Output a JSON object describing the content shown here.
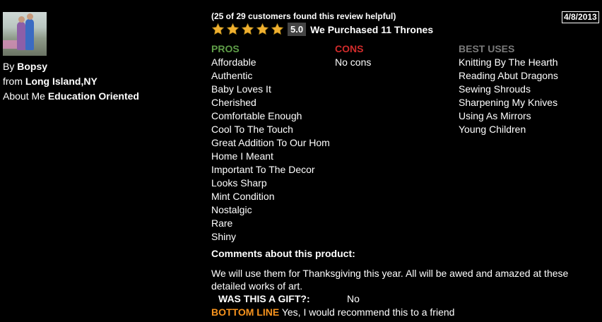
{
  "reviewer": {
    "by_label": "By",
    "name": "Bopsy",
    "from_label": "from",
    "location": "Long Island,NY",
    "about_label": "About Me",
    "about": "Education Oriented"
  },
  "review": {
    "helpful_text": "(25 of 29 customers found this review helpful)",
    "date": "4/8/2013",
    "rating": "5.0",
    "stars": 5,
    "headline": "We Purchased 11 Thrones"
  },
  "pros": {
    "label": "PROS",
    "items": [
      "Affordable",
      "Authentic",
      "Baby Loves It",
      "Cherished",
      "Comfortable Enough",
      "Cool To The Touch",
      "Great Addition To Our Hom",
      "Home I Meant",
      "Important To The Decor",
      "Looks Sharp",
      "Mint Condition",
      "Nostalgic",
      "Rare",
      "Shiny"
    ]
  },
  "cons": {
    "label": "CONS",
    "items": [
      "No cons"
    ]
  },
  "best_uses": {
    "label": "BEST USES",
    "items": [
      "Knitting By The Hearth",
      "Reading Abut Dragons",
      "Sewing Shrouds",
      "Sharpening My Knives",
      "Using As Mirrors",
      "Young Children"
    ]
  },
  "comments": {
    "label": "Comments about this product:",
    "text": "We will use them for Thanksgiving this year. All will be awed and amazed at these detailed works of art."
  },
  "gift": {
    "label": "WAS THIS A GIFT?:",
    "value": "No"
  },
  "bottom_line": {
    "label": "BOTTOM LINE",
    "text": "Yes, I would recommend this to a friend"
  },
  "colors": {
    "pros": "#5f9e48",
    "cons": "#d12b2b",
    "best_uses": "#7a7a7a",
    "bottom_line": "#f7931e",
    "star": "#f0b030"
  }
}
